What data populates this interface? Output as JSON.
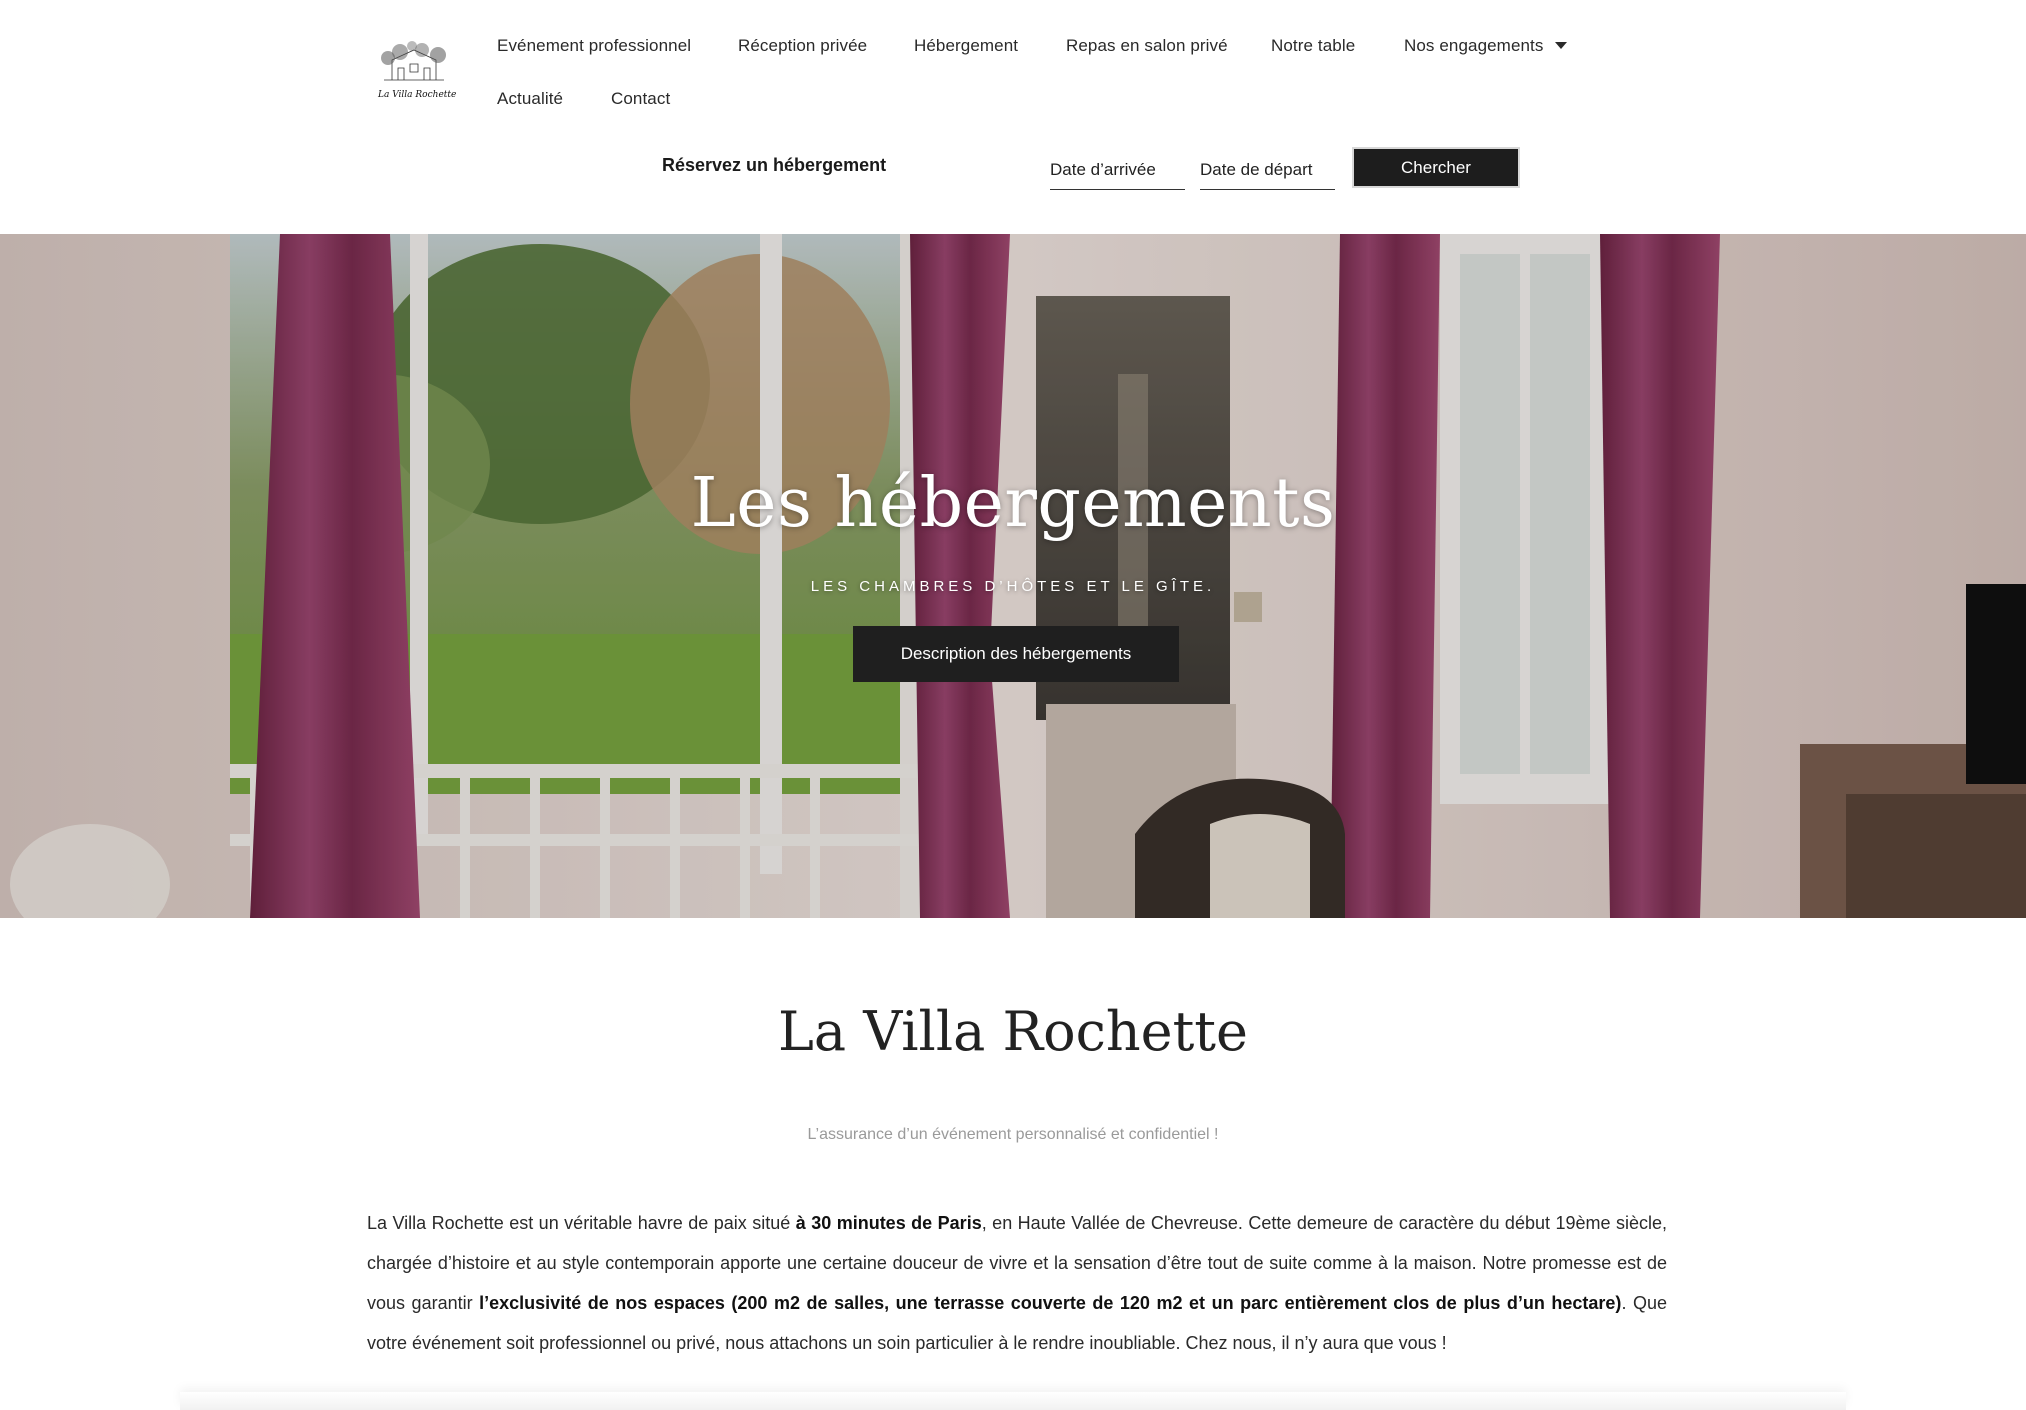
{
  "header": {
    "logo_text": "La Villa Rochette",
    "nav": [
      {
        "label": "Evénement professionnel"
      },
      {
        "label": "Réception privée"
      },
      {
        "label": "Hébergement"
      },
      {
        "label": "Repas en salon privé"
      },
      {
        "label": "Notre table"
      },
      {
        "label": "Nos engagements",
        "has_dropdown": true
      },
      {
        "label": "Actualité"
      },
      {
        "label": "Contact"
      }
    ],
    "booking": {
      "label": "Réservez un hébergement",
      "arrival_placeholder": "Date d’arrivée",
      "departure_placeholder": "Date de départ",
      "search_label": "Chercher"
    }
  },
  "hero": {
    "title": "Les hébergements",
    "subtitle": "LES CHAMBRES D’HÔTES ET LE GÎTE.",
    "button_label": "Description des hébergements"
  },
  "intro": {
    "title": "La Villa Rochette",
    "tagline": "L’assurance d’un événement personnalisé et confidentiel !",
    "p1": "La Villa Rochette est un véritable havre de paix situé ",
    "b1": "à 30 minutes de Paris",
    "p2": ", en Haute Vallée de Chevreuse.  Cette demeure de caractère du début 19ème siècle, chargée d’histoire et au style contemporain apporte une certaine douceur de vivre et la sensation d’être tout de suite comme à la maison. Notre promesse est de vous garantir ",
    "b2": "l’exclusivité de nos espaces (200 m2 de salles, une terrasse couverte de 120 m2 et un parc entièrement clos de plus d’un hectare)",
    "p3": ". Que votre événement soit professionnel ou privé, nous attachons un soin particulier à le rendre inoubliable. Chez nous, il n’y aura que vous !"
  },
  "colors": {
    "button_dark": "#1f1f1f",
    "curtain": "#8e3b5e",
    "tagline_grey": "#9a9a9a"
  }
}
